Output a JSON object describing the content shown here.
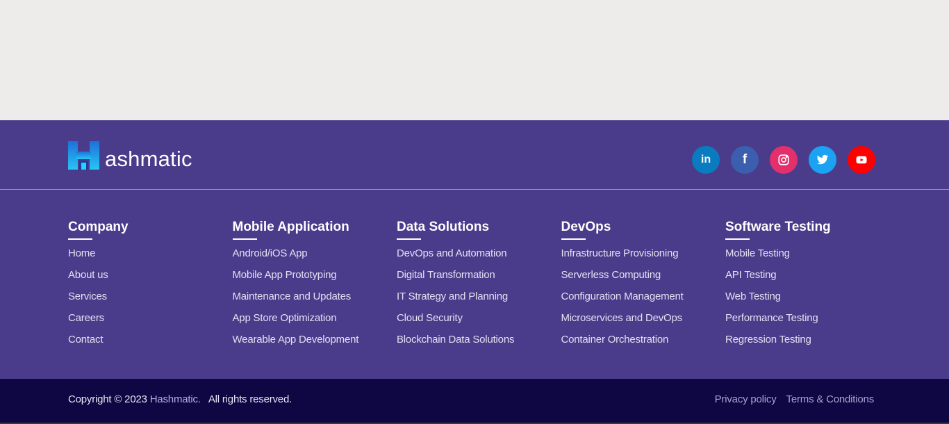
{
  "brand": {
    "logo_text": "ashmatic",
    "logo_icon": "hashmatic-h-logo-icon"
  },
  "socials": [
    {
      "name": "LinkedIn",
      "icon": "linkedin-icon",
      "color": "#0a7bbf",
      "glyph": "in"
    },
    {
      "name": "Facebook",
      "icon": "facebook-icon",
      "color": "#3b5fae",
      "glyph": "f"
    },
    {
      "name": "Instagram",
      "icon": "instagram-icon",
      "color": "#e1306c"
    },
    {
      "name": "Twitter",
      "icon": "twitter-icon",
      "color": "#1da1f2"
    },
    {
      "name": "YouTube",
      "icon": "youtube-icon",
      "color": "#ff0000"
    }
  ],
  "columns": [
    {
      "title": "Company",
      "links": [
        "Home",
        "About us",
        "Services",
        "Careers",
        "Contact"
      ]
    },
    {
      "title": "Mobile Application",
      "links": [
        "Android/iOS App",
        "Mobile App Prototyping",
        "Maintenance and Updates",
        "App Store Optimization",
        "Wearable App Development"
      ]
    },
    {
      "title": "Data Solutions",
      "links": [
        "DevOps and Automation",
        "Digital Transformation",
        "IT Strategy and Planning",
        "Cloud Security",
        "Blockchain Data Solutions"
      ]
    },
    {
      "title": "DevOps",
      "links": [
        "Infrastructure Provisioning",
        "Serverless Computing",
        "Configuration Management",
        "Microservices and DevOps",
        "Container Orchestration"
      ]
    },
    {
      "title": "Software Testing",
      "links": [
        "Mobile Testing",
        "API Testing",
        "Web Testing",
        "Performance Testing",
        "Regression Testing"
      ]
    }
  ],
  "footer_bottom": {
    "copyright_prefix": "Copyright © 2023",
    "copyright_brand": "Hashmatic.",
    "copyright_suffix": "All rights reserved.",
    "privacy_label": "Privacy policy",
    "terms_label": "Terms & Conditions"
  },
  "colors": {
    "footer_bg": "#4a3c8b",
    "bottom_bar_bg": "#0e0744",
    "page_bg": "#edecea"
  }
}
